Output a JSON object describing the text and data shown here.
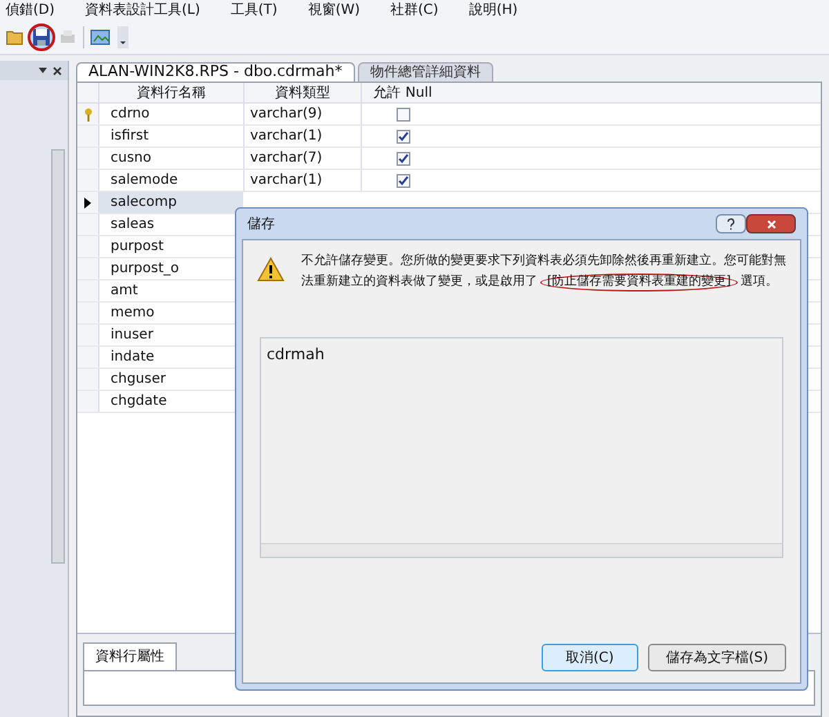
{
  "menu_bar": [
    "偵錯(D)",
    "資料表設計工具(L)",
    "工具(T)",
    "視窗(W)",
    "社群(C)",
    "說明(H)"
  ],
  "toolbar": {
    "save_circled": true
  },
  "tabs": [
    {
      "label": "ALAN-WIN2K8.RPS - dbo.cdrmah*",
      "selected": true
    },
    {
      "label": "物件總管詳細資料",
      "selected": false
    }
  ],
  "grid": {
    "columns": [
      "資料行名稱",
      "資料類型",
      "允許 Null"
    ],
    "rows": [
      {
        "name": "cdrno",
        "type": "varchar(9)",
        "allow_null": false,
        "primary_key": true,
        "selected": false
      },
      {
        "name": "isfirst",
        "type": "varchar(1)",
        "allow_null": true,
        "primary_key": false,
        "selected": false
      },
      {
        "name": "cusno",
        "type": "varchar(7)",
        "allow_null": true,
        "primary_key": false,
        "selected": false
      },
      {
        "name": "salemode",
        "type": "varchar(1)",
        "allow_null": true,
        "primary_key": false,
        "selected": false
      },
      {
        "name": "salecomp",
        "primary_key": false,
        "selected": true
      },
      {
        "name": "saleas",
        "primary_key": false,
        "selected": false
      },
      {
        "name": "purpost",
        "primary_key": false,
        "selected": false
      },
      {
        "name": "purpost_o",
        "primary_key": false,
        "selected": false
      },
      {
        "name": "amt",
        "primary_key": false,
        "selected": false
      },
      {
        "name": "memo",
        "primary_key": false,
        "selected": false
      },
      {
        "name": "inuser",
        "primary_key": false,
        "selected": false
      },
      {
        "name": "indate",
        "primary_key": false,
        "selected": false
      },
      {
        "name": "chguser",
        "primary_key": false,
        "selected": false
      },
      {
        "name": "chgdate",
        "primary_key": false,
        "selected": false
      }
    ]
  },
  "properties_tab": {
    "label": "資料行屬性",
    "selected": true
  },
  "dialog": {
    "title": "儲存",
    "message_parts": [
      {
        "text": "不允許儲存變更。您所做的變更要求下列資料表必須先卸除然後再重新建立。您可能對無法重新建立的資料表做了變更，或是啟用了",
        "circled": false
      },
      {
        "text": "[防止儲存需要資料表重建的變更]",
        "circled": true
      },
      {
        "text": "選項。",
        "circled": false
      }
    ],
    "tables": [
      "cdrmah"
    ],
    "buttons": [
      {
        "label": "取消(C)",
        "focused": true
      },
      {
        "label": "儲存為文字檔(S)",
        "focused": false
      }
    ]
  }
}
